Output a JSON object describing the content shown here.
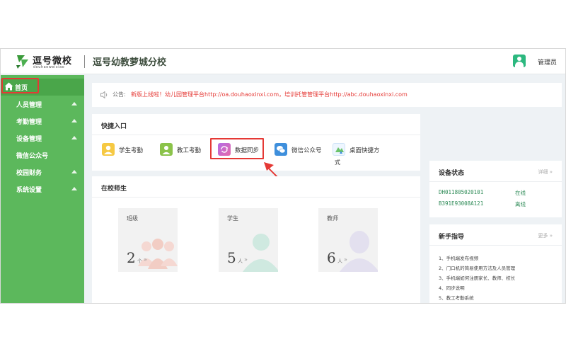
{
  "header": {
    "logo_name": "逗号微校",
    "logo_sub": "douhaoweixiao",
    "school_title": "逗号幼教萝城分校",
    "user_name": "管理员"
  },
  "sidebar": {
    "items": [
      {
        "label": "首页",
        "icon": "home-icon",
        "active": true
      },
      {
        "label": "人员管理",
        "expandable": true
      },
      {
        "label": "考勤管理",
        "expandable": true
      },
      {
        "label": "设备管理",
        "expandable": true
      },
      {
        "label": "微信公众号",
        "expandable": false
      },
      {
        "label": "校园财务",
        "expandable": true
      },
      {
        "label": "系统设置",
        "expandable": true
      }
    ],
    "color": "#5cb85c"
  },
  "notice": {
    "prefix": "公告:",
    "text": "新版上线啦！幼儿园管理平台http://oa.douhaoxinxi.com，培训托管管理平台http://abc.douhaoxinxi.com"
  },
  "quick_entry": {
    "title": "快捷入口",
    "items": [
      {
        "label": "学生考勤",
        "icon": "student-attendance-icon"
      },
      {
        "label": "教工考勤",
        "icon": "staff-attendance-icon"
      },
      {
        "label": "数据同步",
        "icon": "sync-icon"
      },
      {
        "label": "微信公众号",
        "icon": "wechat-icon"
      },
      {
        "label": "桌面快捷方",
        "icon": "desktop-shortcut-icon"
      }
    ],
    "wrap_text": "式"
  },
  "staff_section": {
    "title": "在校师生",
    "cards": [
      {
        "label": "班级",
        "value": "2",
        "unit": "个"
      },
      {
        "label": "学生",
        "value": "5",
        "unit": "人"
      },
      {
        "label": "教师",
        "value": "6",
        "unit": "人"
      }
    ],
    "go_symbol": "»"
  },
  "device_status": {
    "title": "设备状态",
    "more": "详细 »",
    "rows": [
      {
        "id": "DH011805020101",
        "status": "在线"
      },
      {
        "id": "B391E93008A121",
        "status": "离线"
      }
    ]
  },
  "guide": {
    "title": "新手指导",
    "more": "更多 »",
    "items": [
      "1、手机端发布视频",
      "2、门口机的简易使用方法及人员管理",
      "3、手机端如何注册家长、教师、校长",
      "4、同步说明",
      "5、教工考勤系统"
    ]
  },
  "colors": {
    "accent": "#5cb85c",
    "highlight": "#e53935",
    "status_text": "#2e8b57"
  }
}
